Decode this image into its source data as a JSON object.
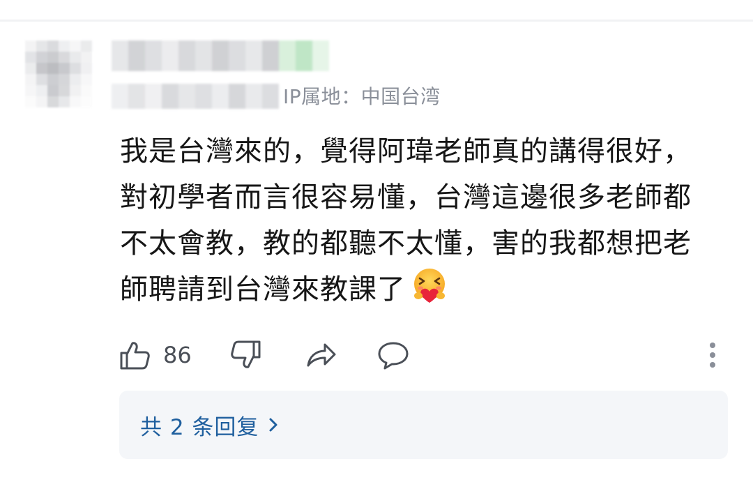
{
  "comment": {
    "ip_location": "IP属地：中国台湾",
    "text": "我是台灣來的，覺得阿瑋老師真的講得很好，對初學者而言很容易懂，台灣這邊很多老師都不太會教，教的都聽不太懂，害的我都想把老師聘請到台灣來教課了",
    "emoji": "hug-heart-emoji"
  },
  "actions": {
    "like_count": "86",
    "like_icon": "thumbs-up-icon",
    "dislike_icon": "thumbs-down-icon",
    "share_icon": "share-arrow-icon",
    "reply_icon": "comment-bubble-icon",
    "more_icon": "more-vertical-icon"
  },
  "replies": {
    "label": "共 2 条回复",
    "chevron": "chevron-right-icon"
  },
  "colors": {
    "link_blue": "#1f5f9e",
    "meta_gray": "#8a8f99",
    "reply_bg": "#f4f6f9"
  }
}
